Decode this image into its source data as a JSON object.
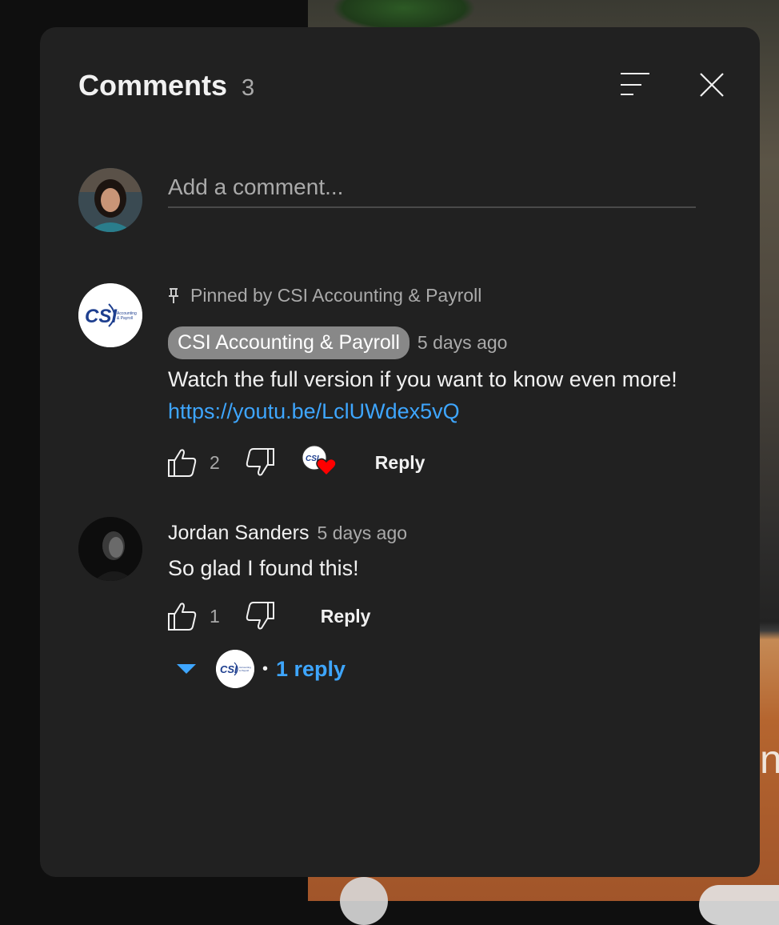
{
  "header": {
    "title": "Comments",
    "count": "3"
  },
  "add_comment": {
    "placeholder": "Add a comment..."
  },
  "comments": [
    {
      "pinned_label": "Pinned by CSI Accounting & Payroll",
      "author": "CSI Accounting & Payroll",
      "timestamp": "5 days ago",
      "text_before_link": "Watch the full version if you want to know even more! ",
      "link": "https://youtu.be/LclUWdex5vQ",
      "likes": "2",
      "reply_label": "Reply",
      "avatar_text": "CSI",
      "avatar_subtext": "Accounting & Payroll"
    },
    {
      "author": "Jordan Sanders",
      "timestamp": "5 days ago",
      "text": "So glad I found this!",
      "likes": "1",
      "reply_label": "Reply",
      "replies_toggle": {
        "dot": "•",
        "label": "1 reply"
      }
    }
  ],
  "colors": {
    "panel_bg": "#212121",
    "link": "#3ea6ff",
    "secondary_text": "#aaaaaa",
    "heart": "#ff0000"
  },
  "icons": {
    "sort": "sort-icon",
    "close": "close-icon",
    "pin": "pin-icon",
    "like": "thumbs-up-icon",
    "dislike": "thumbs-down-icon",
    "heart": "heart-icon",
    "expand": "triangle-down-icon"
  }
}
